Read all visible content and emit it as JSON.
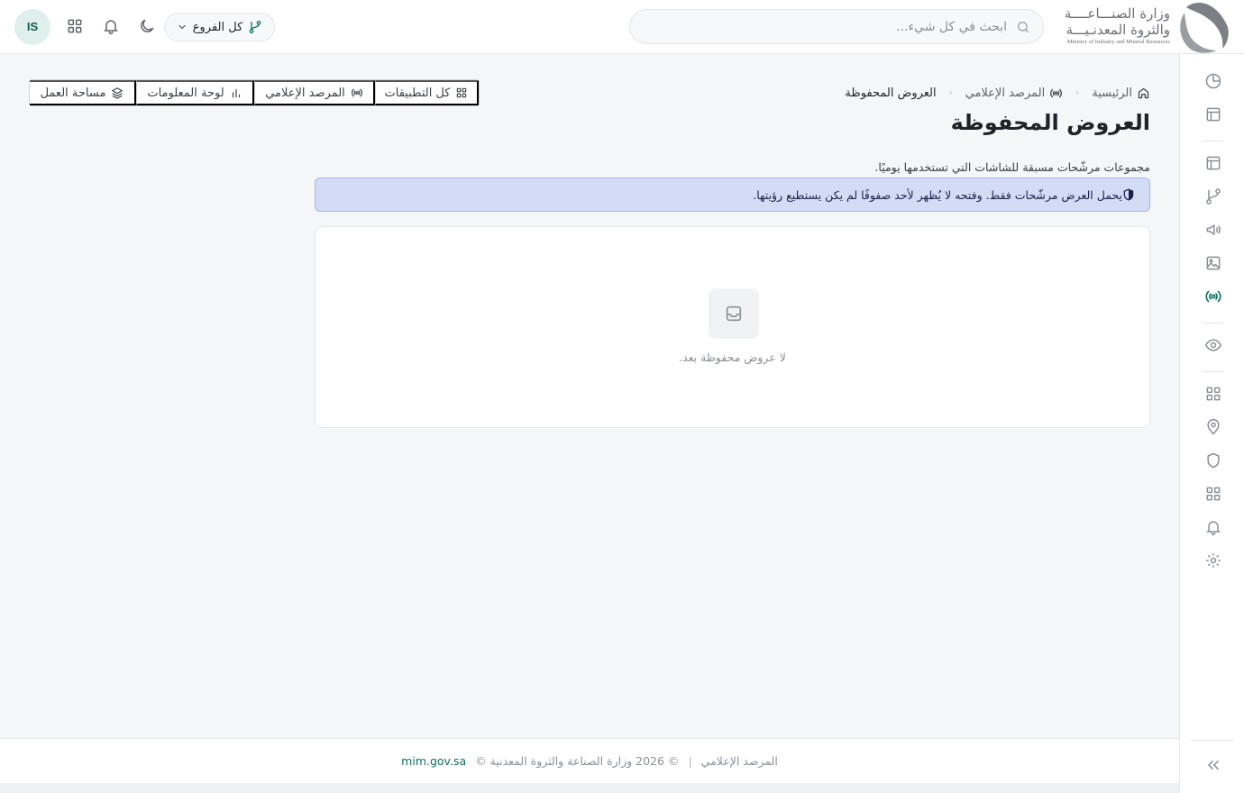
{
  "logo": {
    "name_line1": "وزارة الصنـــاعــــة",
    "name_line2": "والثروة المعدنـيـــة",
    "name_en": "Ministry of Industry and Mineral Resources"
  },
  "search": {
    "placeholder": "ابحث في كل شيء..."
  },
  "branch_selector": {
    "label": "كل الفروع"
  },
  "user": {
    "initials": "IS"
  },
  "breadcrumb": {
    "home": "الرئيسية",
    "section": "المرصد الإعلامي",
    "current": "العروض المحفوظة"
  },
  "page": {
    "title": "العروض المحفوظة",
    "description": "مجموعات مرشّحات مسبقة للشاشات التي تستخدمها يوميًا.",
    "notice": "يحمل العرض مرشّحات فقط. وفتحه لا يُظهر لأحد صفوفًا لم يكن يستطيع رؤيتها."
  },
  "quicknav": {
    "all_apps": "كل التطبيقات",
    "media_monitor": "المرصد الإعلامي",
    "dashboard": "لوحة المعلومات",
    "workspace": "مساحة العمل"
  },
  "empty_state": {
    "message": "لا عروض محفوظة بعد."
  },
  "footer": {
    "app_name": "المرصد الإعلامي",
    "separator": "|",
    "copyright": "© 2026 وزارة الصناعة والثروة المعدنية ©",
    "link": "mim.gov.sa"
  },
  "sidebar_icons": [
    "chart-pie-icon",
    "layout-icon",
    "layout-icon",
    "branch-icon",
    "megaphone-icon",
    "image-icon",
    "broadcast-icon",
    "eye-icon",
    "grid-icon",
    "location-icon",
    "shield-icon",
    "grid-icon",
    "bell-icon",
    "gear-icon"
  ],
  "colors": {
    "accent": "#0f6e62",
    "notice_bg": "#d3dcf5",
    "notice_border": "#a9b8e8",
    "avatar_bg": "#dff0ec"
  }
}
